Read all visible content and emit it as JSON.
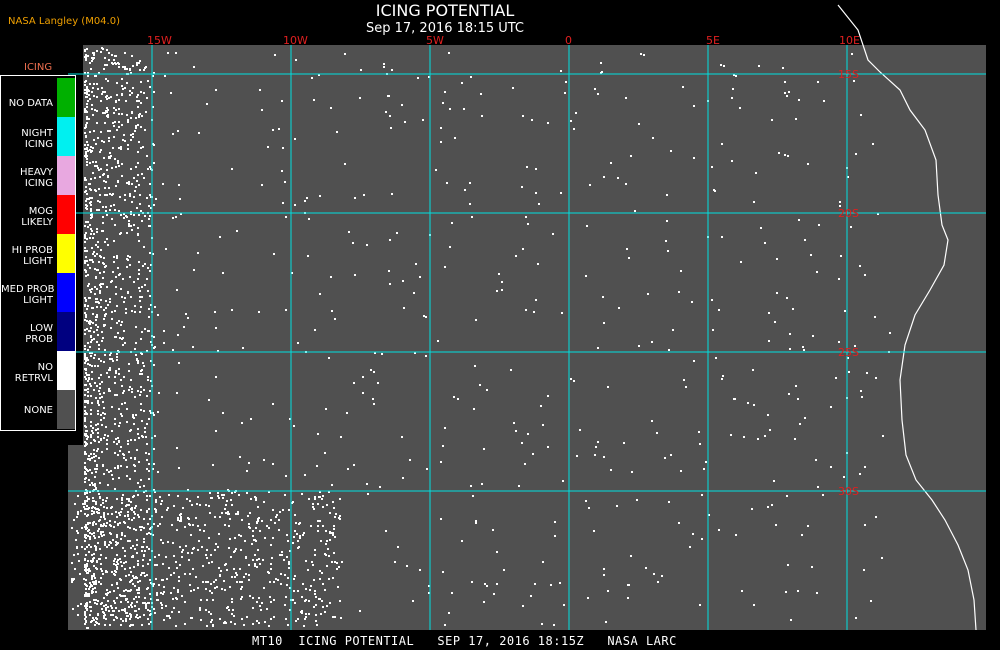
{
  "credit": "NASA Langley (M04.0)",
  "title": "ICING POTENTIAL",
  "subtitle": "Sep 17, 2016 18:15 UTC",
  "bottom_caption": "MT10  ICING POTENTIAL   SEP 17, 2016 18:15Z   NASA LARC",
  "legend": {
    "title": "ICING",
    "items": [
      {
        "label": "NO DATA",
        "color": "#00b000"
      },
      {
        "label": "NIGHT\nICING",
        "color": "#00f0f0"
      },
      {
        "label": "HEAVY\nICING",
        "color": "#e8a8e0"
      },
      {
        "label": "MOG\nLIKELY",
        "color": "#ff0000"
      },
      {
        "label": "HI PROB\nLIGHT",
        "color": "#ffff00"
      },
      {
        "label": "MED PROB\nLIGHT",
        "color": "#0000ff"
      },
      {
        "label": "LOW\nPROB",
        "color": "#000080"
      },
      {
        "label": "NO\nRETRVL",
        "color": "#ffffff"
      },
      {
        "label": "NONE",
        "color": "#505050"
      }
    ]
  },
  "map": {
    "background_color": "#505050",
    "grid_color": "#00e0e0",
    "lon_labels": [
      "15W",
      "10W",
      "5W",
      "0",
      "5E",
      "10E"
    ],
    "lat_labels": [
      "15S",
      "20S",
      "25S",
      "30S"
    ],
    "label_color": "#e02020"
  }
}
